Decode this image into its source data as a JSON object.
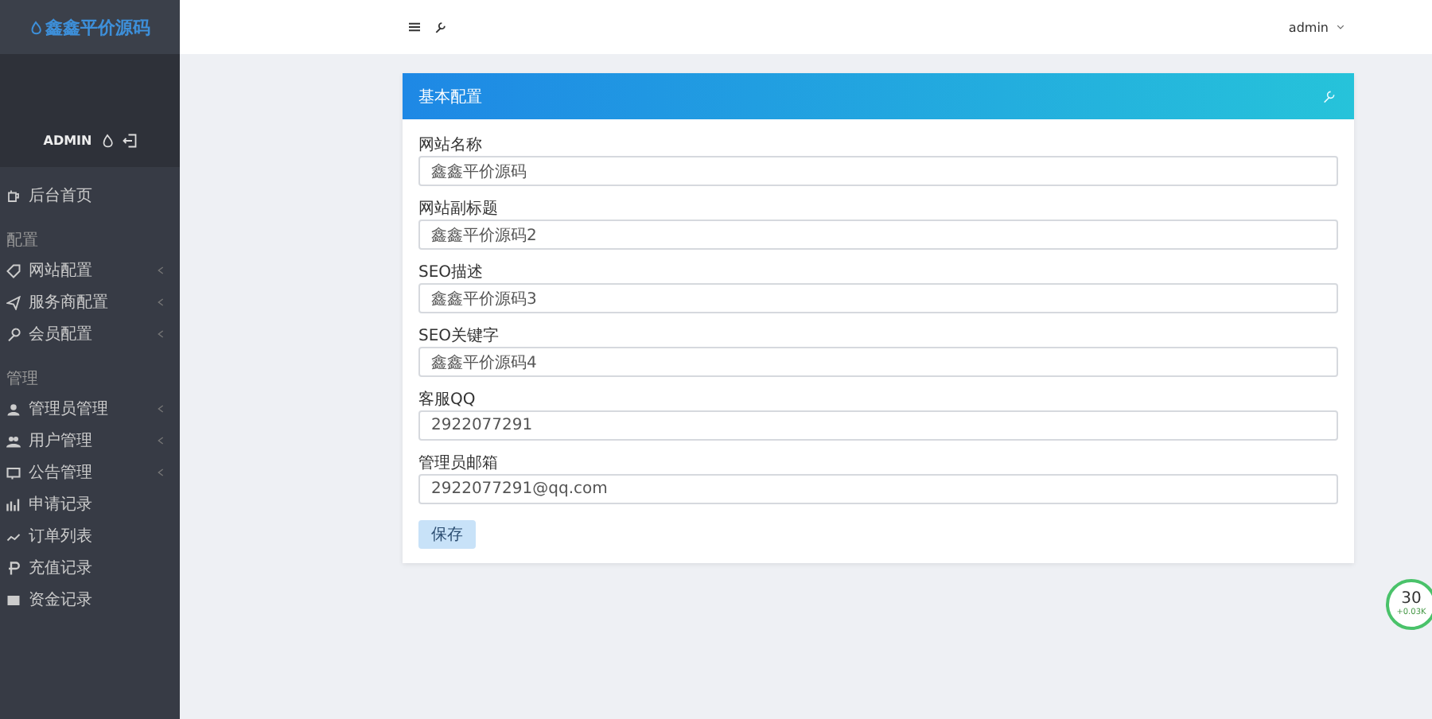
{
  "sidebar": {
    "logo": "鑫鑫平价源码",
    "user": "ADMIN",
    "home": {
      "label": "后台首页"
    },
    "sections": [
      {
        "title": "配置",
        "items": [
          {
            "label": "网站配置",
            "expandable": true
          },
          {
            "label": "服务商配置",
            "expandable": true
          },
          {
            "label": "会员配置",
            "expandable": true
          }
        ]
      },
      {
        "title": "管理",
        "items": [
          {
            "label": "管理员管理",
            "expandable": true
          },
          {
            "label": "用户管理",
            "expandable": true
          },
          {
            "label": "公告管理",
            "expandable": true
          },
          {
            "label": "申请记录",
            "expandable": false
          },
          {
            "label": "订单列表",
            "expandable": false
          },
          {
            "label": "充值记录",
            "expandable": false
          },
          {
            "label": "资金记录",
            "expandable": false
          }
        ]
      }
    ]
  },
  "topbar": {
    "user": "admin"
  },
  "card": {
    "title": "基本配置",
    "fields": [
      {
        "label": "网站名称",
        "value": "鑫鑫平价源码"
      },
      {
        "label": "网站副标题",
        "value": "鑫鑫平价源码2"
      },
      {
        "label": "SEO描述",
        "value": "鑫鑫平价源码3"
      },
      {
        "label": "SEO关键字",
        "value": "鑫鑫平价源码4"
      },
      {
        "label": "客服QQ",
        "value": "2922077291"
      },
      {
        "label": "管理员邮箱",
        "value": "2922077291@qq.com"
      }
    ],
    "button": "保存"
  },
  "speed_widget": {
    "percent": "30",
    "rate": "+0.03K"
  }
}
